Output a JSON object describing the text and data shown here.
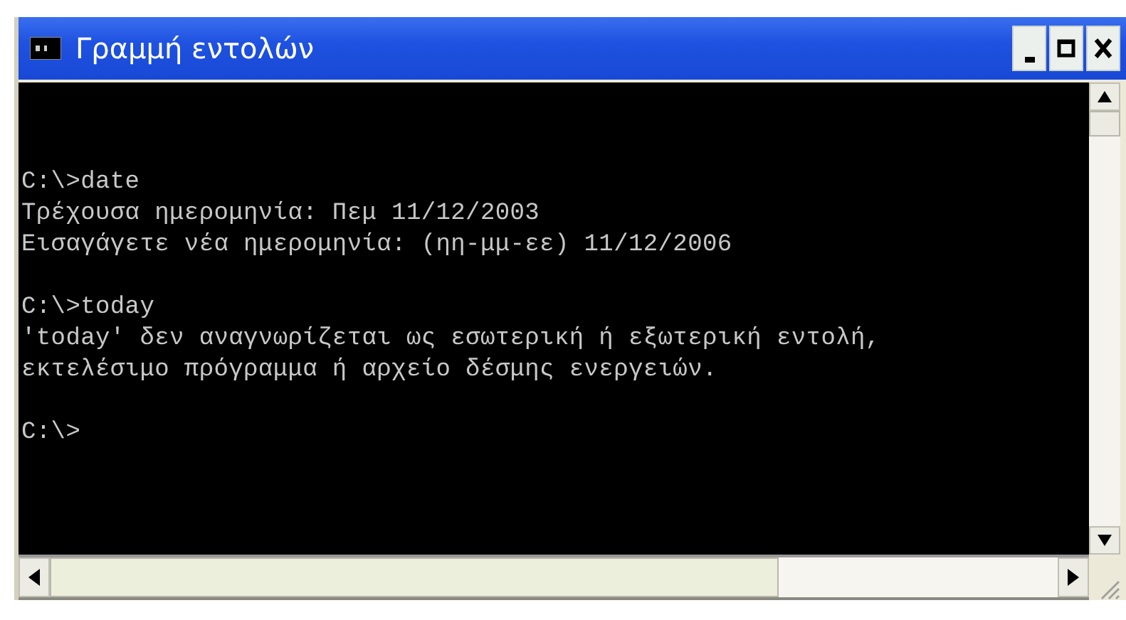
{
  "window": {
    "title": "Γραμμή εντολών"
  },
  "console": {
    "blocks": [
      [
        "C:\\>date",
        "Τρέχουσα ημερομηνία: Πεμ 11/12/2003",
        "Εισαγάγετε νέα ημερομηνία: (ηη-μμ-εε) 11/12/2006"
      ],
      [
        "C:\\>today",
        "'today' δεν αναγνωρίζεται ως εσωτερική ή εξωτερική εντολή,",
        "εκτελέσιμο πρόγραμμα ή αρχείο δέσμης ενεργειών."
      ],
      [
        "C:\\>"
      ]
    ]
  }
}
